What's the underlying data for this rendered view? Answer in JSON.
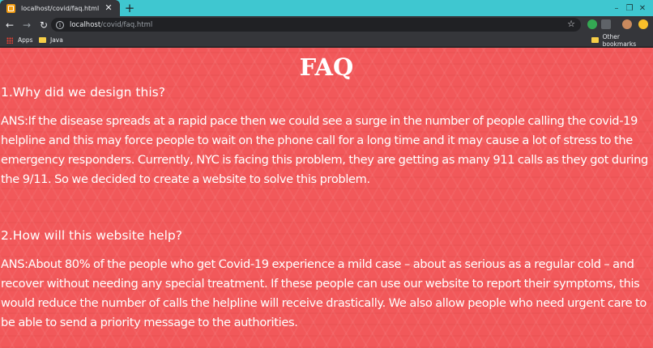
{
  "browser": {
    "tab_title": "localhost/covid/faq.html",
    "tab_close": "✕",
    "new_tab": "+",
    "url_host": "localhost",
    "url_path": "/covid/faq.html",
    "bookmarks": {
      "apps": "Apps",
      "java": "Java",
      "other": "Other bookmarks"
    },
    "window_controls": [
      "–",
      "❐",
      "✕"
    ],
    "icons": {
      "back": "back-arrow-icon",
      "forward": "forward-arrow-icon",
      "reload": "reload-icon",
      "info": "site-info-icon",
      "star": "bookmark-star-icon"
    }
  },
  "page": {
    "title": "FAQ",
    "faqs": [
      {
        "question": "1.Why did we design this?",
        "answer": "ANS:If the disease spreads at a rapid pace then we could see a surge in the number of people calling the covid-19 helpline and this may force people to wait on the phone call for a long time and it may cause a lot of stress to the emergency responders. Currently, NYC is facing this problem, they are getting as many 911 calls as they got during the 9/11. So we decided to create a website to solve this problem."
      },
      {
        "question": "2.How will this website help?",
        "answer": "ANS:About 80% of the people who get Covid-19 experience a mild case – about as serious as a regular cold – and recover without needing any special treatment. If these people can use our website to report their symptoms, this would reduce the number of calls the helpline will receive drastically. We also allow people who need urgent care to be able to send a priority message to the authorities."
      }
    ]
  },
  "colors": {
    "page_background": "#f2585a",
    "tab_strip": "#3fc7d0",
    "text": "#ffffff"
  }
}
